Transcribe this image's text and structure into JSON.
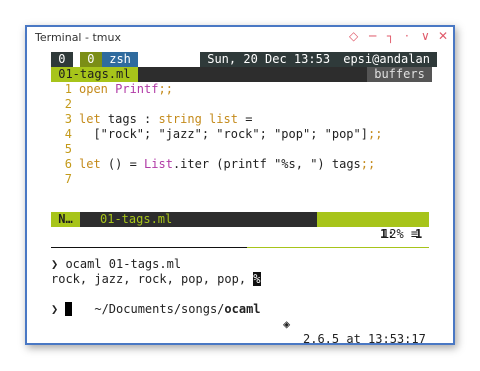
{
  "window": {
    "title": "Terminal - tmux",
    "controls": [
      "◇",
      "─",
      "┐",
      "·",
      "∨",
      "✕"
    ]
  },
  "tmux": {
    "win0": " 0 ",
    "win1_num": " 0 ",
    "win1_name": " zsh ",
    "date": " Sun, 20 Dec 13:53 ",
    "host": " epsi@andalan "
  },
  "vim": {
    "tab": " 01-tags.ml ",
    "buffers": " buffers ",
    "lines": [
      {
        "n": "1",
        "parts": [
          [
            "kw",
            "open "
          ],
          [
            "md",
            "Printf"
          ],
          [
            "op",
            ";;"
          ]
        ]
      },
      {
        "n": "2",
        "parts": []
      },
      {
        "n": "3",
        "parts": [
          [
            "kw",
            "let "
          ],
          [
            "tx",
            "tags : "
          ],
          [
            "ty",
            "string list"
          ],
          [
            "tx",
            " ="
          ]
        ]
      },
      {
        "n": "4",
        "parts": [
          [
            "tx",
            "  [\"rock\"; \"jazz\"; \"rock\"; \"pop\"; \"pop\"]"
          ],
          [
            "op",
            ";;"
          ]
        ]
      },
      {
        "n": "5",
        "parts": []
      },
      {
        "n": "6",
        "parts": [
          [
            "kw",
            "let "
          ],
          [
            "tx",
            "() = "
          ],
          [
            "md",
            "List"
          ],
          [
            "tx",
            ".iter (printf \"%s, \") tags"
          ],
          [
            "op",
            ";;"
          ]
        ]
      },
      {
        "n": "7",
        "parts": []
      }
    ],
    "status": {
      "mode": " N… ",
      "file": "01-tags.ml",
      "percent": " 12% ≡ ",
      "line": "1:",
      "col": "1 "
    }
  },
  "shell": {
    "prompt1": "❯ ocaml 01-tags.ml",
    "output": "rock, jazz, rock, pop, pop, ",
    "output_end_glyph": "%",
    "path_prefix": "~/Documents/songs/",
    "path_dir": "ocaml",
    "ruby_icon": "◈",
    "version_time": "2.6.5 at 13:53:17",
    "prompt2": "❯ "
  }
}
